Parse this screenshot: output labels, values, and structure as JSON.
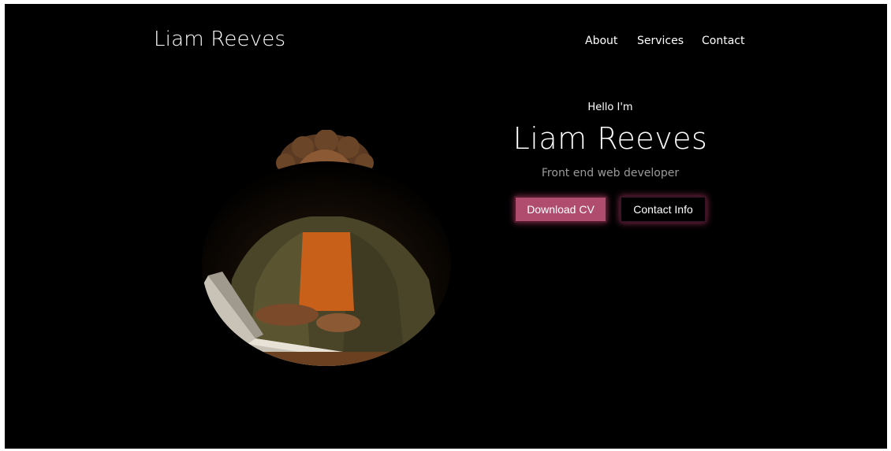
{
  "header": {
    "logo": "Liam Reeves",
    "nav": [
      {
        "label": "About"
      },
      {
        "label": "Services"
      },
      {
        "label": "Contact"
      }
    ]
  },
  "hero": {
    "greeting": "Hello I'm",
    "name": "Liam Reeves",
    "subtitle": "Front end web developer",
    "primary_button": "Download CV",
    "secondary_button": "Contact Info"
  },
  "colors": {
    "background": "#000000",
    "text": "#ffffff",
    "subtitle": "#9a9a9a",
    "accent": "#b04d6e"
  }
}
